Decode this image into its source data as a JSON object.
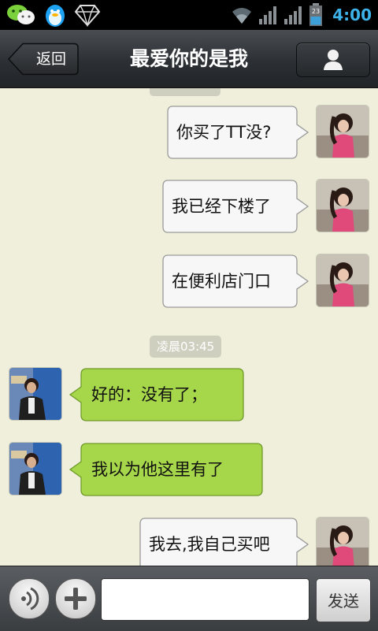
{
  "status_bar": {
    "clock": "4:00",
    "battery_level": "23",
    "notification_icons": [
      "wechat-icon",
      "qq-penguin-icon",
      "diamond-icon"
    ],
    "system_icons": [
      "wifi-icon",
      "signal-icon",
      "signal-icon",
      "battery-icon"
    ],
    "clock_color": "#3db2e8"
  },
  "header": {
    "back_label": "返回",
    "title": "最爱你的是我",
    "profile_icon": "person-icon"
  },
  "chat": {
    "timestamps": [
      "凌晨03:45"
    ],
    "messages": [
      {
        "from": "me",
        "text": "你买了TT没?"
      },
      {
        "from": "me",
        "text": "我已经下楼了"
      },
      {
        "from": "me",
        "text": "在便利店门口"
      },
      {
        "from": "friend",
        "text": "好的：没有了；"
      },
      {
        "from": "friend",
        "text": "我以为他这里有了"
      },
      {
        "from": "me",
        "text": "我去,我自己买吧"
      }
    ],
    "colors": {
      "background": "#efefdc",
      "outgoing_bubble": "#f7f7f7",
      "incoming_bubble": "#a6d64a"
    }
  },
  "input_bar": {
    "voice_icon": "voice-icon",
    "plus_icon": "plus-icon",
    "message_value": "",
    "send_label": "发送"
  }
}
